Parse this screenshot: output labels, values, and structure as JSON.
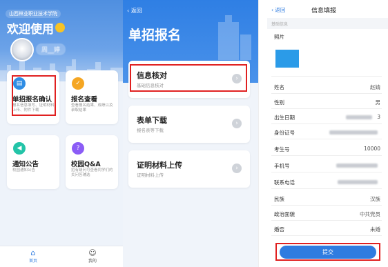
{
  "home": {
    "school_name": "山西林业职业技术学院",
    "welcome": "欢迎使用",
    "user_name": "周__婷",
    "cards": [
      {
        "title": "单招报名确认",
        "desc": "报名信息填写、证明材料上传、附件下载",
        "icon": "document-icon",
        "color": "#2f8de4"
      },
      {
        "title": "报名查看",
        "desc": "查看报名结果、成绩以及录取结果",
        "icon": "check-icon",
        "color": "#f5a623"
      },
      {
        "title": "通知公告",
        "desc": "校园通知公告",
        "icon": "megaphone-icon",
        "color": "#23c4a8"
      },
      {
        "title": "校园Q&A",
        "desc": "招有疑问可查看同学们的关问答辅选",
        "icon": "question-icon",
        "color": "#8b5cf6"
      }
    ],
    "tabbar": [
      {
        "label": "首页",
        "icon": "home-icon"
      },
      {
        "label": "我的",
        "icon": "smile-icon"
      }
    ]
  },
  "apply": {
    "back": "返回",
    "title": "单招报名",
    "items": [
      {
        "title": "信息核对",
        "subtitle": "基础信息核对"
      },
      {
        "title": "表单下载",
        "subtitle": "报名表等下载"
      },
      {
        "title": "证明材料上传",
        "subtitle": "证明材料上传"
      }
    ]
  },
  "info": {
    "back": "返回",
    "title": "信息填报",
    "section": "基础信息",
    "photo_label": "照片",
    "fields": [
      {
        "label": "姓名",
        "value": "赵婧"
      },
      {
        "label": "性别",
        "value": "男"
      },
      {
        "label": "出生日期",
        "value": "3"
      },
      {
        "label": "身份证号",
        "value": ""
      },
      {
        "label": "考生号",
        "value": "10000"
      },
      {
        "label": "手机号",
        "value": ""
      },
      {
        "label": "联系电话",
        "value": ""
      },
      {
        "label": "民族",
        "value": "汉族"
      },
      {
        "label": "政治面貌",
        "value": "中共党员"
      },
      {
        "label": "婚否",
        "value": "未婚"
      }
    ],
    "submit": "提交"
  },
  "colors": {
    "primary": "#2f7ce0",
    "highlight_box": "#e02020"
  }
}
